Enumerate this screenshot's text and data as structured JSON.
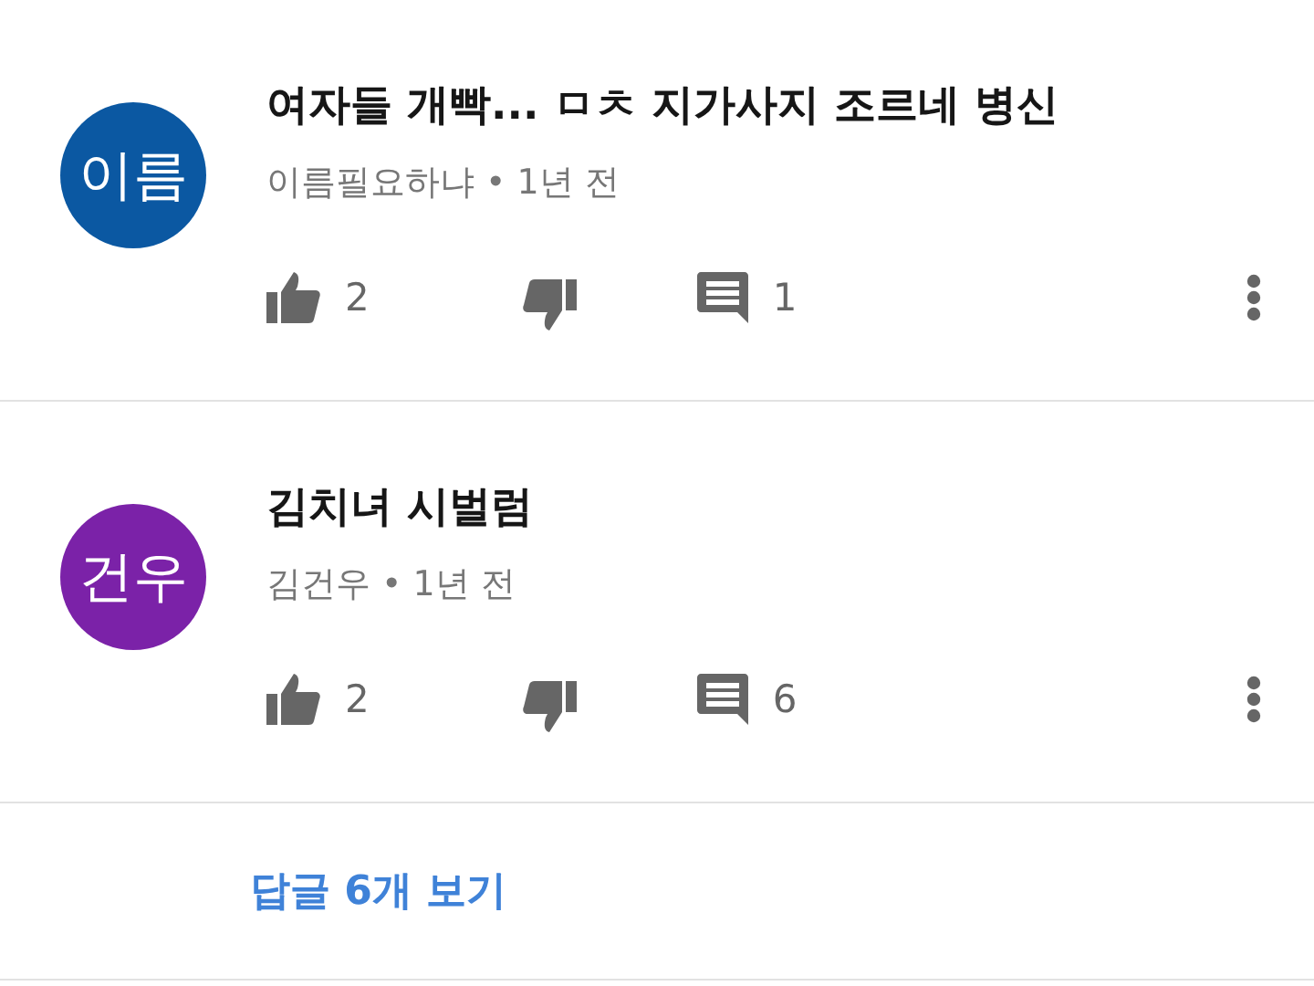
{
  "comments": [
    {
      "avatar": {
        "initials": "이름",
        "color": "#0b58a2"
      },
      "text": "여자들 개빡...  ㅁㅊ 지가사지 조르네 병신",
      "meta": "이름필요하냐 • 1년 전",
      "likes": "2",
      "replies": "1"
    },
    {
      "avatar": {
        "initials": "건우",
        "color": "#7b22a8"
      },
      "text": "김치녀 시벌럼",
      "meta": "김건우 • 1년 전",
      "likes": "2",
      "replies": "6"
    }
  ],
  "view_replies": "답글 6개 보기"
}
